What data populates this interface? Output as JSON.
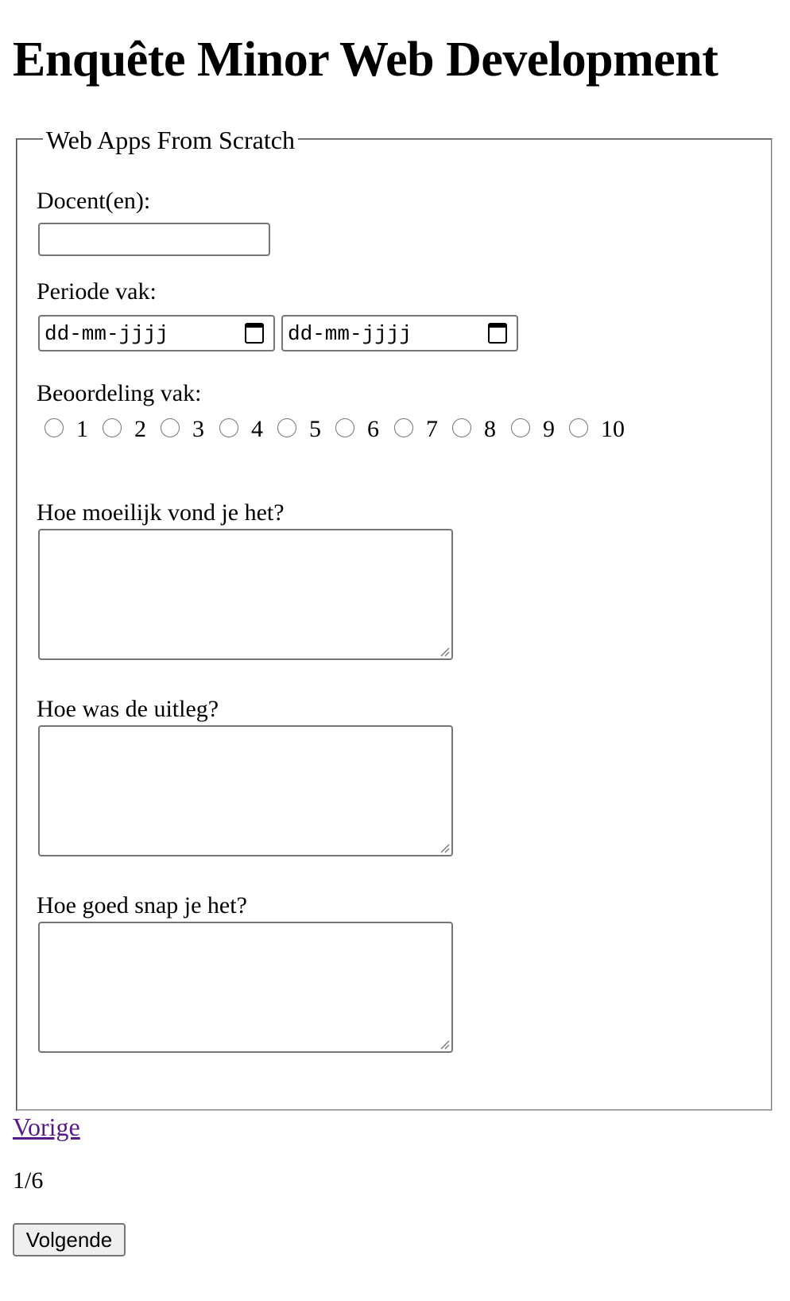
{
  "page": {
    "title": "Enquête Minor Web Development"
  },
  "form": {
    "section_legend": "Web Apps From Scratch",
    "teacher": {
      "label": "Docent(en):",
      "value": ""
    },
    "period": {
      "label": "Periode vak:",
      "start_placeholder": "dd-mm-jjjj",
      "end_placeholder": "dd-mm-jjjj"
    },
    "rating": {
      "label": "Beoordeling vak:",
      "options": [
        "1",
        "2",
        "3",
        "4",
        "5",
        "6",
        "7",
        "8",
        "9",
        "10"
      ],
      "selected": null
    },
    "questions": [
      {
        "label": "Hoe moeilijk vond je het?",
        "value": ""
      },
      {
        "label": "Hoe was de uitleg?",
        "value": ""
      },
      {
        "label": "Hoe goed snap je het?",
        "value": ""
      }
    ]
  },
  "nav": {
    "previous_label": "Vorige",
    "page_indicator": "1/6",
    "next_label": "Volgende"
  },
  "icons": {
    "date_picker": "calendar-icon",
    "textarea_corner": "resize-grip-icon"
  },
  "colors": {
    "visited_link": "#551a8b",
    "control_border": "#767676",
    "button_bg": "#efefef"
  }
}
